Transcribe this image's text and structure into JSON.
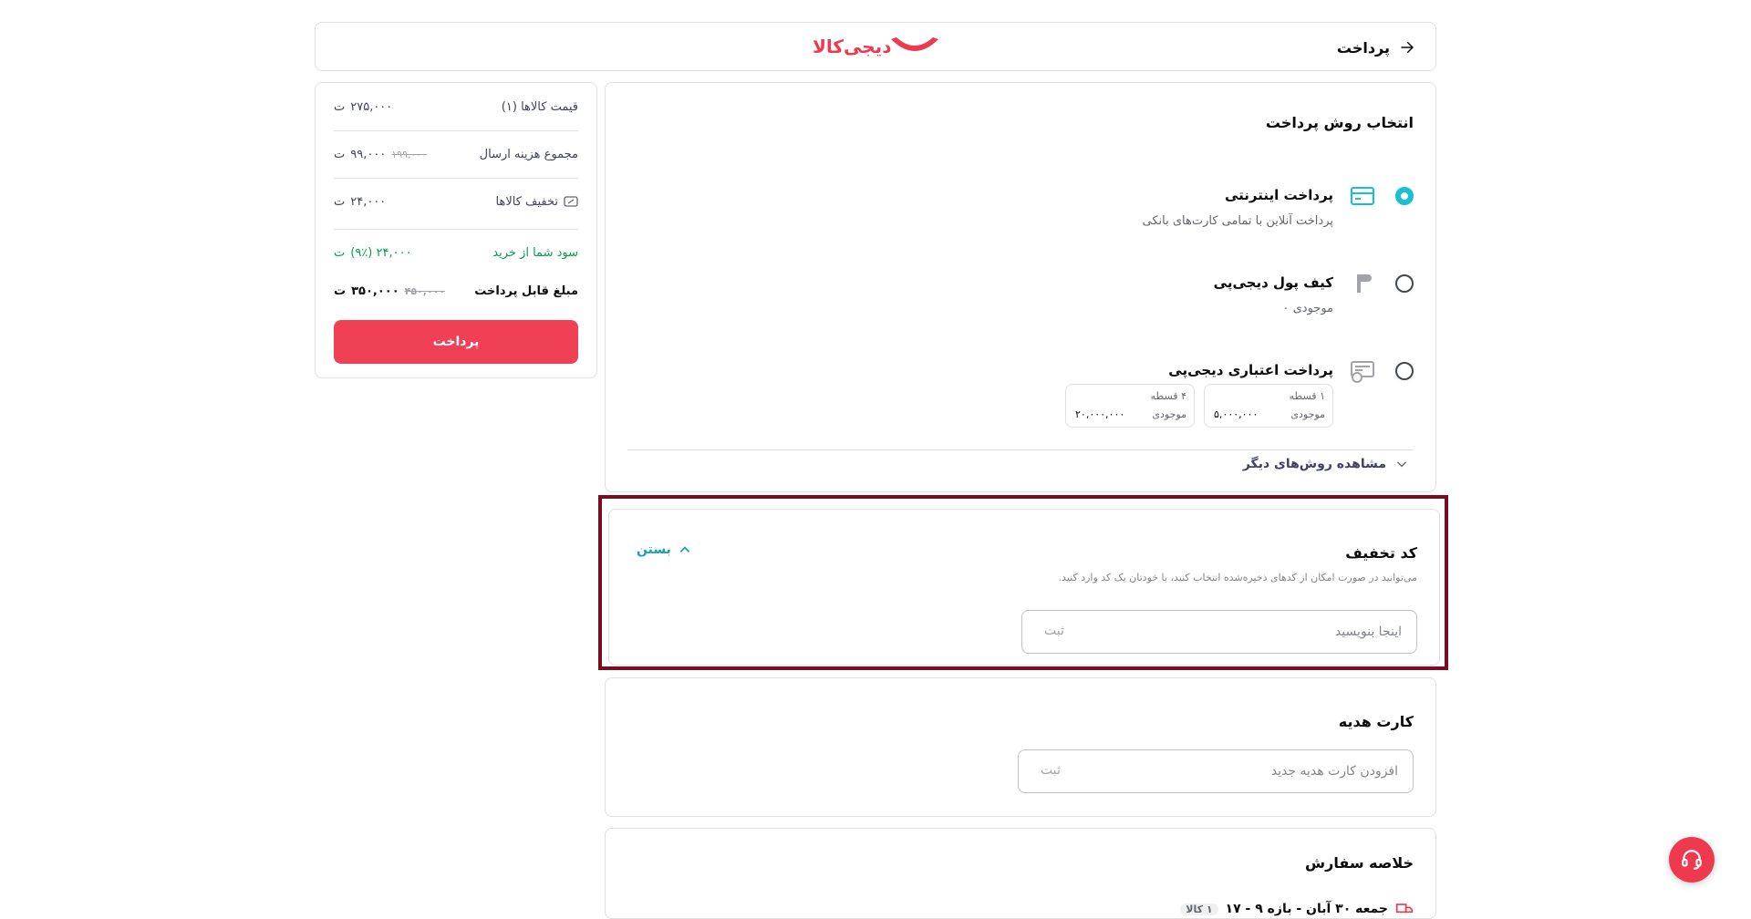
{
  "header": {
    "back_label": "پرداخت",
    "logo_text": "دیجی‌کالا",
    "brand_color": "#ef394e"
  },
  "payment": {
    "title": "انتخاب روش پرداخت",
    "options": [
      {
        "title": "پرداخت اینترنتی",
        "subtitle": "پرداخت آنلاین با تمامی کارت‌های بانکی",
        "selected": true,
        "icon": "card-icon"
      },
      {
        "title": "کیف پول دیجی‌پی",
        "subtitle": "موجودی ۰",
        "selected": false,
        "icon": "wallet-icon"
      },
      {
        "title": "پرداخت اعتباری دیجی‌پی",
        "subtitle": "",
        "selected": false,
        "icon": "credit-icon"
      }
    ],
    "credit_plans": [
      {
        "installments": "۱ قسطه",
        "balance_label": "موجودی",
        "amount": "۵,۰۰۰,۰۰۰"
      },
      {
        "installments": "۴ قسطه",
        "balance_label": "موجودی",
        "amount": "۲۰,۰۰۰,۰۰۰"
      }
    ],
    "more_label": "مشاهده روش‌های دیگر"
  },
  "discount": {
    "title": "کد تخفیف",
    "close_label": "بستن",
    "description": "می‌توانید در صورت امکان از کدهای ذخیره‌شده انتخاب کنید، یا خودتان یک کد وارد کنید.",
    "placeholder": "اینجا بنویسید",
    "submit_label": "ثبت"
  },
  "gift": {
    "title": "کارت هدیه",
    "placeholder": "افزودن کارت هدیه جدید",
    "submit_label": "ثبت"
  },
  "order_summary": {
    "title": "خلاصه سفارش",
    "delivery_text": "جمعه ۳۰ آبان - بازه ۹ - ۱۷",
    "badge": "۱ کالا"
  },
  "sidebar": {
    "rows": [
      {
        "label": "قیمت کالاها (۱)",
        "value": "۲۷۵,۰۰۰",
        "old": ""
      },
      {
        "label": "مجموع هزینه ارسال",
        "value": "۹۹,۰۰۰",
        "old": "۱۹۹,۰۰۰"
      },
      {
        "label": "تخفیف کالاها",
        "value": "۲۴,۰۰۰",
        "old": ""
      },
      {
        "label": "سود شما از خرید",
        "value": "۲۴,۰۰۰ (۹٪)",
        "old": ""
      },
      {
        "label": "مبلغ قابل پرداخت",
        "value": "۳۵۰,۰۰۰",
        "old": "۴۵۰,۰۰۰"
      }
    ],
    "pay_label": "پرداخت",
    "currency_symbol": "ت"
  }
}
